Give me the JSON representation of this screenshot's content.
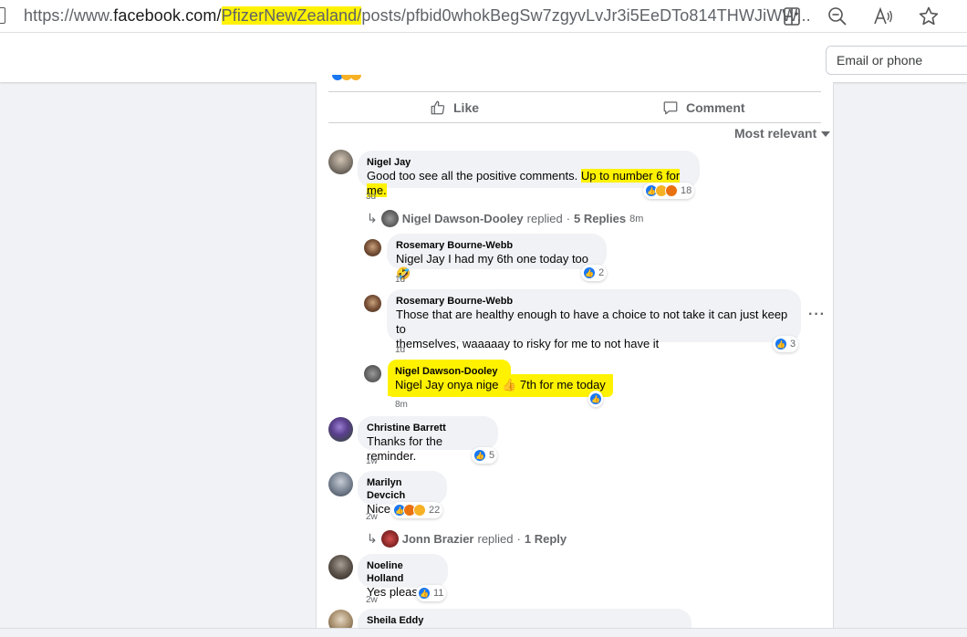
{
  "browser": {
    "url_prefix": "https://www.",
    "url_host": "facebook.com/",
    "url_highlight": "PfizerNewZealand/",
    "url_rest": "posts/pfbid0whokBegSw7zgyvLvJr3i5EeDTo814THWJiWW...",
    "icons": [
      "split-screen-icon",
      "zoom-out-icon",
      "read-aloud-icon",
      "favorite-star-icon"
    ]
  },
  "header": {
    "email_placeholder": "Email or phone"
  },
  "post_actions": {
    "like": "Like",
    "comment": "Comment",
    "sort": "Most relevant"
  },
  "comments": [
    {
      "author": "Nigel Jay",
      "text_a": "Good too see all the positive comments. ",
      "text_b": "Up to number 6 for me.",
      "time": "3d",
      "reaction_count": "18"
    },
    {
      "thread_summary": {
        "name": "Nigel Dawson-Dooley",
        "action": "replied",
        "sep": "·",
        "replies": "5 Replies",
        "time": "8m"
      }
    },
    {
      "author": "Rosemary Bourne-Webb",
      "text": "Nigel Jay I had my 6th one today too 🤣",
      "time": "1d",
      "reaction_count": "2"
    },
    {
      "author": "Rosemary Bourne-Webb",
      "text_line1": "Those that are healthy enough to have a choice to not take it can just keep to",
      "text_line2": "themselves, waaaaay to risky for me to not have it",
      "time": "1d",
      "reaction_count": "3"
    },
    {
      "author": "Nigel Dawson-Dooley",
      "text": "Nigel Jay onya nige 👍 7th for me today",
      "time": "8m"
    },
    {
      "author": "Christine Barrett",
      "text": "Thanks for the reminder.",
      "time": "1w",
      "reaction_count": "5"
    },
    {
      "author": "Marilyn Devcich",
      "text": "Nice try 😂",
      "time": "2w",
      "reaction_count": "22"
    },
    {
      "thread_summary": {
        "name": "Jonn Brazier",
        "action": "replied",
        "sep": "·",
        "replies": "1 Reply"
      }
    },
    {
      "author": "Noeline Holland",
      "text": "Yes please",
      "time": "2w",
      "reaction_count": "11"
    },
    {
      "author": "Sheila Eddy"
    }
  ],
  "colors": {
    "highlight": "#fff200",
    "like_blue": "#1877f2",
    "secondary_text": "#65676b",
    "page_bg": "#f0f2f5"
  }
}
